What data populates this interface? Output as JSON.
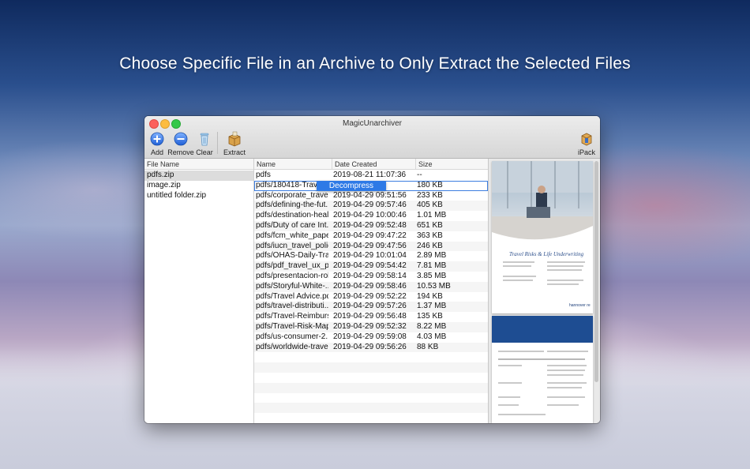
{
  "headline": "Choose Specific File in an Archive to Only Extract the Selected Files",
  "window": {
    "title": "MagicUnarchiver",
    "toolbar": {
      "add": "Add",
      "remove": "Remove",
      "clear": "Clear",
      "extract": "Extract",
      "ipack": "iPack"
    }
  },
  "archives": {
    "header": "File Name",
    "items": [
      "pdfs.zip",
      "image.zip",
      "untitled folder.zip"
    ],
    "selected_index": 0
  },
  "files": {
    "headers": {
      "name": "Name",
      "date": "Date Created",
      "size": "Size"
    },
    "rows": [
      {
        "name": "pdfs",
        "date": "2019-08-21 11:07:36",
        "size": "--"
      },
      {
        "name": "pdfs/180418-Travel",
        "date": ":56:14",
        "size": "180 KB"
      },
      {
        "name": "pdfs/corporate_travel...",
        "date": "2019-04-29 09:51:56",
        "size": "233 KB"
      },
      {
        "name": "pdfs/defining-the-fut...",
        "date": "2019-04-29 09:57:46",
        "size": "405 KB"
      },
      {
        "name": "pdfs/destination-heal...",
        "date": "2019-04-29 10:00:46",
        "size": "1.01 MB"
      },
      {
        "name": "pdfs/Duty of care Int...",
        "date": "2019-04-29 09:52:48",
        "size": "651 KB"
      },
      {
        "name": "pdfs/fcm_white_pape...",
        "date": "2019-04-29 09:47:22",
        "size": "363 KB"
      },
      {
        "name": "pdfs/iucn_travel_polic...",
        "date": "2019-04-29 09:47:56",
        "size": "246 KB"
      },
      {
        "name": "pdfs/OHAS-Daily-Tra...",
        "date": "2019-04-29 10:01:04",
        "size": "2.89 MB"
      },
      {
        "name": "pdfs/pdf_travel_ux_pl...",
        "date": "2019-04-29 09:54:42",
        "size": "7.81 MB"
      },
      {
        "name": "pdfs/presentacion-rol...",
        "date": "2019-04-29 09:58:14",
        "size": "3.85 MB"
      },
      {
        "name": "pdfs/Storyful-White-...",
        "date": "2019-04-29 09:58:46",
        "size": "10.53 MB"
      },
      {
        "name": "pdfs/Travel Advice.pdf",
        "date": "2019-04-29 09:52:22",
        "size": "194 KB"
      },
      {
        "name": "pdfs/travel-distributi...",
        "date": "2019-04-29 09:57:26",
        "size": "1.37 MB"
      },
      {
        "name": "pdfs/Travel-Reimburs...",
        "date": "2019-04-29 09:56:48",
        "size": "135 KB"
      },
      {
        "name": "pdfs/Travel-Risk-Map...",
        "date": "2019-04-29 09:52:32",
        "size": "8.22 MB"
      },
      {
        "name": "pdfs/us-consumer-2...",
        "date": "2019-04-29 09:59:08",
        "size": "4.03 MB"
      },
      {
        "name": "pdfs/worldwide-trave...",
        "date": "2019-04-29 09:56:26",
        "size": "88 KB"
      }
    ],
    "focused_index": 1,
    "context_action": "Decompress"
  },
  "preview": {
    "page1_heading": "Travel Risks & Life Underwriting",
    "page1_brand": "hannover re"
  },
  "colors": {
    "accent": "#2e7ae6",
    "close": "#fc605c",
    "minimize": "#fdbc40",
    "maximize": "#34c84a"
  }
}
